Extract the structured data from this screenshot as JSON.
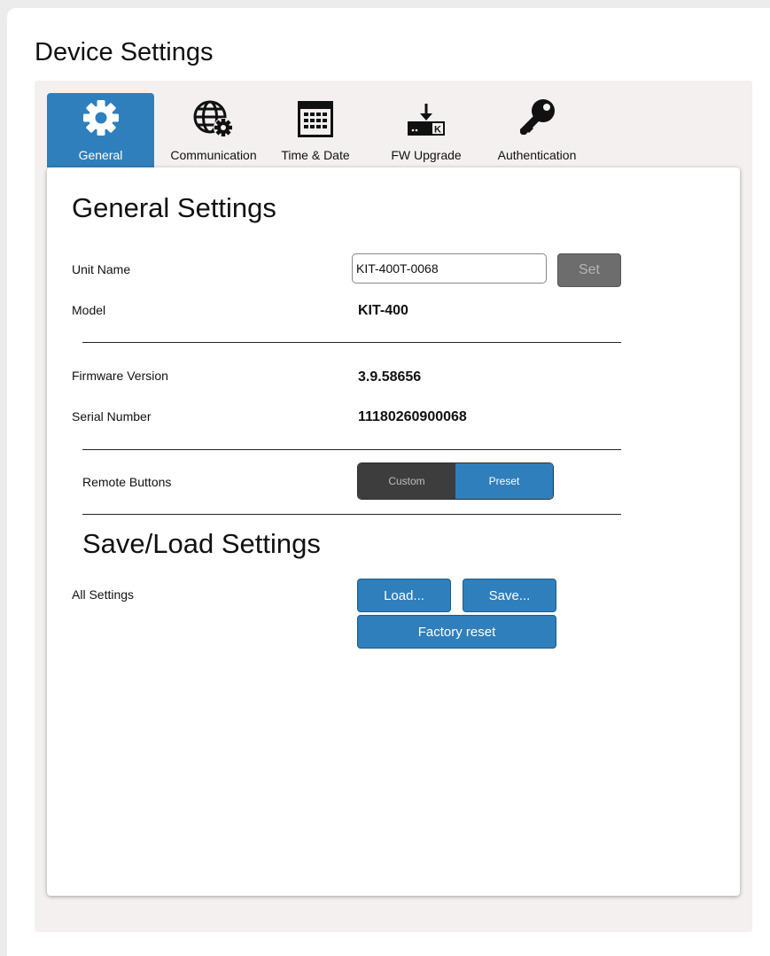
{
  "page": {
    "title": "Device Settings"
  },
  "tabs": [
    {
      "label": "General",
      "icon": "gear-icon",
      "active": true
    },
    {
      "label": "Communication",
      "icon": "globe-gear-icon",
      "active": false
    },
    {
      "label": "Time & Date",
      "icon": "calendar-icon",
      "active": false
    },
    {
      "label": "FW Upgrade",
      "icon": "firmware-download-icon",
      "active": false
    },
    {
      "label": "Authentication",
      "icon": "key-icon",
      "active": false
    }
  ],
  "general": {
    "title": "General Settings",
    "unit_name_label": "Unit Name",
    "unit_name_value": "KIT-400T-0068",
    "set_label": "Set",
    "model_label": "Model",
    "model_value": "KIT-400",
    "firmware_label": "Firmware Version",
    "firmware_value": "3.9.58656",
    "serial_label": "Serial Number",
    "serial_value": "11180260900068",
    "remote_label": "Remote Buttons",
    "remote_options": [
      "Custom",
      "Preset"
    ],
    "remote_selected": "Preset"
  },
  "save_load": {
    "title": "Save/Load Settings",
    "all_label": "All Settings",
    "load_label": "Load...",
    "save_label": "Save...",
    "reset_label": "Factory reset"
  },
  "colors": {
    "accent": "#2f7fbc",
    "panel_bg": "#f4f0f0",
    "toggle_off": "#3d3d3d",
    "disabled_button": "#6d6d6d"
  }
}
